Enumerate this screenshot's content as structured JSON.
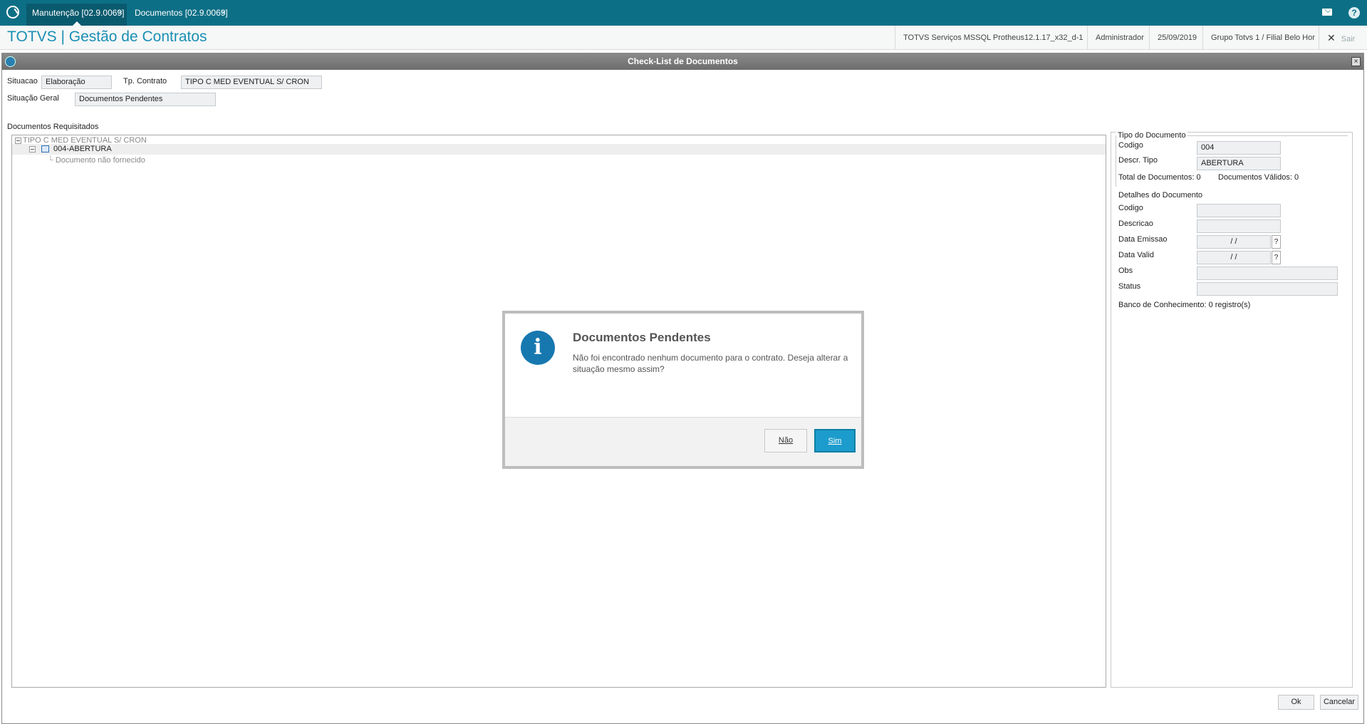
{
  "tabs": [
    {
      "label": "Manutenção [02.9.0069]",
      "close": "×"
    },
    {
      "label": "Documentos [02.9.0069]",
      "close": "×"
    }
  ],
  "header": {
    "title": "TOTVS | Gestão de Contratos",
    "environment": "TOTVS Serviços MSSQL Protheus12.1.17_x32_d-1",
    "user": "Administrador",
    "date": "25/09/2019",
    "company": "Grupo Totvs 1 / Filial Belo Hor",
    "exit_label": "Sair"
  },
  "window": {
    "title": "Check-List de Documentos",
    "close": "×"
  },
  "form": {
    "situacao_label": "Situacao",
    "situacao_value": "Elaboração",
    "tp_contrato_label": "Tp. Contrato",
    "tp_contrato_value": "TIPO C MED EVENTUAL S/ CRON",
    "situacao_geral_label": "Situação Geral",
    "situacao_geral_value": "Documentos Pendentes",
    "docs_req_label": "Documentos Requisitados"
  },
  "tree": {
    "root": "TIPO C MED EVENTUAL S/ CRON",
    "child": "004-ABERTURA",
    "leaf": "Documento não fornecido"
  },
  "side": {
    "tipo_title": "Tipo do Documento",
    "codigo_label": "Codigo",
    "codigo_value": "004",
    "descr_tipo_label": "Descr. Tipo",
    "descr_tipo_value": "ABERTURA",
    "total_docs": "Total de Documentos: 0",
    "docs_validos": "Documentos Válidos: 0",
    "detalhes_title": "Detalhes do Documento",
    "det_codigo_label": "Codigo",
    "det_descricao_label": "Descricao",
    "data_emissao_label": "Data Emissao",
    "data_emissao_value": "/  /",
    "data_valid_label": "Data Valid",
    "data_valid_value": "/  /",
    "obs_label": "Obs",
    "status_label": "Status",
    "banco": "Banco de Conhecimento: 0 registro(s)",
    "lookup": "?"
  },
  "buttons": {
    "ok": "Ok",
    "cancelar": "Cancelar"
  },
  "message": {
    "icon": "i",
    "title": "Documentos Pendentes",
    "text": "Não foi encontrado nenhum documento para o contrato. Deseja alterar a situação mesmo assim?",
    "no": "Não",
    "yes": "Sim"
  }
}
